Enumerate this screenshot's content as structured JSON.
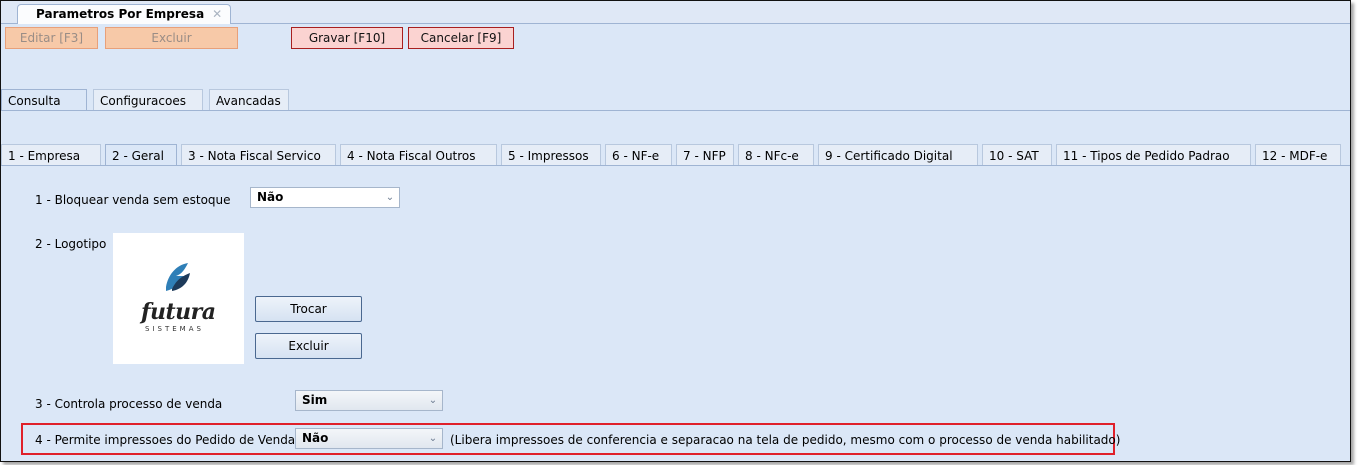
{
  "document_tab": {
    "title": "Parametros Por Empresa",
    "close": "✕"
  },
  "toolbar": {
    "edit_label": "Editar [F3]",
    "delete_label": "Excluir",
    "save_label": "Gravar [F10]",
    "cancel_label": "Cancelar [F9]"
  },
  "section_tabs": [
    "Consulta",
    "Configuracoes",
    "Avancadas"
  ],
  "sub_tabs": [
    "1 - Empresa",
    "2 - Geral",
    "3 - Nota Fiscal Servico",
    "4 - Nota Fiscal Outros",
    "5 - Impressos",
    "6 - NF-e",
    "7 - NFP",
    "8 - NFc-e",
    "9 - Certificado Digital",
    "10 - SAT",
    "11 - Tipos de Pedido Padrao",
    "12 - MDF-e"
  ],
  "fields": {
    "bloquear": {
      "label": "1 - Bloquear venda sem estoque",
      "value": "Não"
    },
    "logotipo": {
      "label": "2 - Logotipo",
      "logo_word": "futura",
      "logo_sub": "SISTEMAS",
      "swap_label": "Trocar",
      "delete_label": "Excluir"
    },
    "controla": {
      "label": "3 - Controla processo de venda",
      "value": "Sim"
    },
    "permite": {
      "label": "4 - Permite impressoes do Pedido de Venda",
      "value": "Não",
      "note": "(Libera impressoes de conferencia e separacao na tela de pedido, mesmo com o processo de venda habilitado)"
    }
  },
  "colors": {
    "highlight": "#e0202a",
    "panel_bg": "#dbe7f7",
    "active_button_border": "#a82020"
  }
}
